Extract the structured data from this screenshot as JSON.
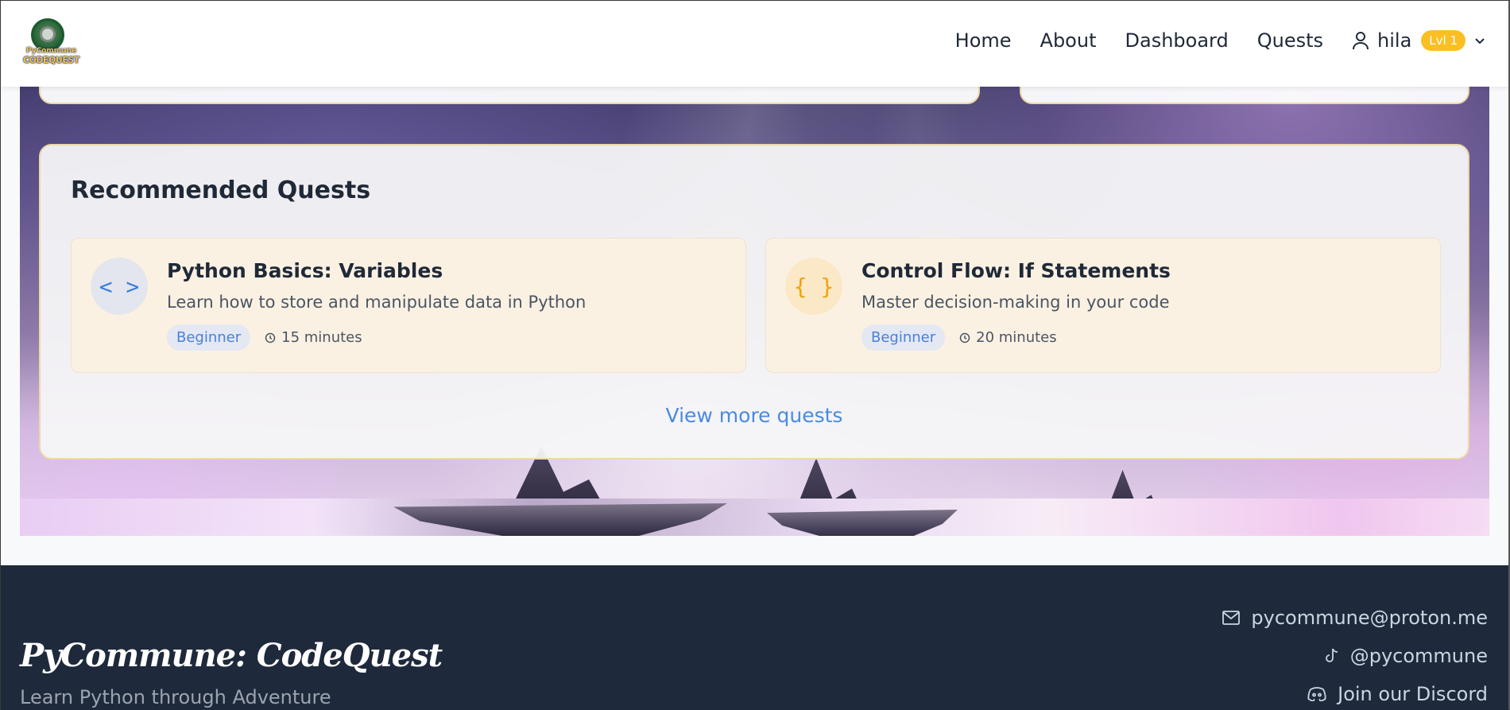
{
  "header": {
    "logo_text_top": "PyCommune",
    "logo_text_bottom": "CODEQUEST",
    "nav": {
      "home": "Home",
      "about": "About",
      "dashboard": "Dashboard",
      "quests": "Quests"
    },
    "user": {
      "name": "hila",
      "level_badge": "Lvl 1"
    }
  },
  "recommended": {
    "title": "Recommended Quests",
    "quests": [
      {
        "icon": "code-brackets-icon",
        "icon_glyph": "< >",
        "title": "Python Basics: Variables",
        "description": "Learn how to store and manipulate data in Python",
        "level": "Beginner",
        "duration": "15 minutes"
      },
      {
        "icon": "curly-braces-icon",
        "icon_glyph": "{ }",
        "title": "Control Flow: If Statements",
        "description": "Master decision-making in your code",
        "level": "Beginner",
        "duration": "20 minutes"
      }
    ],
    "view_more": "View more quests"
  },
  "footer": {
    "brand": "PyCommune: CodeQuest",
    "tagline": "Learn Python through Adventure",
    "email": "pycommune@proton.me",
    "tiktok": "@pycommune",
    "discord": "Join our Discord"
  },
  "colors": {
    "accent_blue": "#4a8ae0",
    "level_badge": "#fbbf24",
    "card_border": "#ecd9a8",
    "footer_bg": "#1e293b"
  }
}
